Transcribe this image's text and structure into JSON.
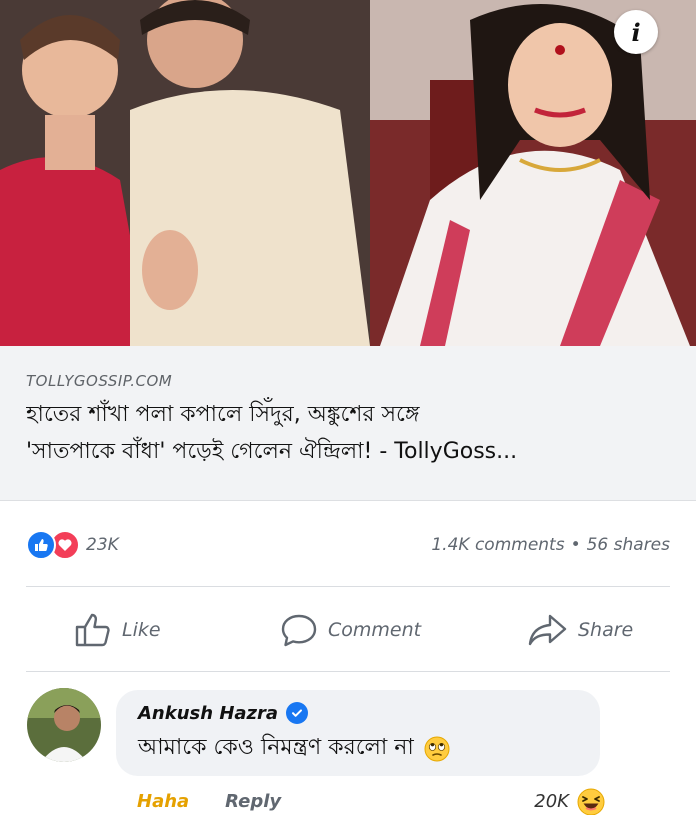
{
  "hero": {
    "info_label": "i"
  },
  "link_preview": {
    "domain": "TOLLYGOSSIP.COM",
    "title_line1": "হাতের শাঁখা পলা কপালে সিঁদুর, অঙ্কুশের সঙ্গে",
    "title_line2": "'সাতপাকে বাঁধা' পড়েই গেলেন ঐন্দ্রিলা! - TollyGoss..."
  },
  "stats": {
    "reactions_count": "23K",
    "comments": "1.4K comments",
    "separator": "•",
    "shares": "56 shares"
  },
  "actions": {
    "like_label": "Like",
    "comment_label": "Comment",
    "share_label": "Share"
  },
  "comment": {
    "author": "Ankush Hazra",
    "text": "আমাকে কেও নিমন্ত্রণ করলো না",
    "haha_label": "Haha",
    "reply_label": "Reply",
    "reaction_count": "20K"
  },
  "colors": {
    "accent": "#1877f2",
    "love": "#f33e58",
    "haha": "#e5a100"
  }
}
